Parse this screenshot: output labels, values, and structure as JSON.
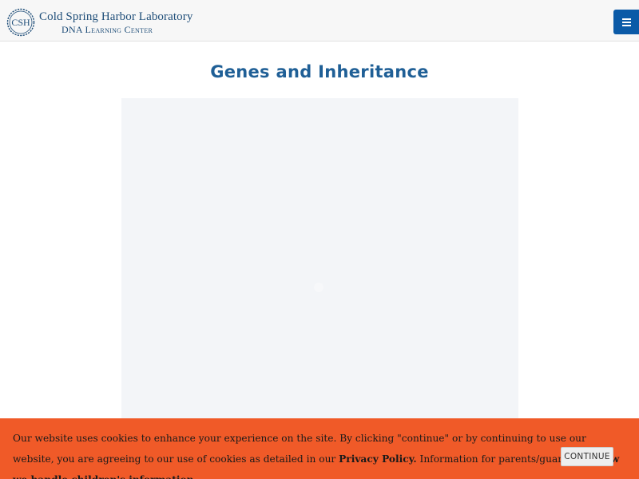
{
  "header": {
    "logo_mark_text": "CSH",
    "logo_line1": "Cold Spring Harbor Laboratory",
    "logo_line2": "DNA Learning Center",
    "menu_icon": "hamburger-menu-icon"
  },
  "main": {
    "title": "Genes and Inheritance"
  },
  "cookie_banner": {
    "text_part1": "Our website uses cookies to enhance your experience on the site. By clicking \"continue\" or by continuing to use our website, you are agreeing to our use of cookies as detailed in our ",
    "privacy_link": "Privacy Policy.",
    "text_part2": " Information for parents/guardians: ",
    "children_link": "How we handle children's information",
    "text_part3": ".",
    "continue_label": "CONTINUE"
  },
  "colors": {
    "header_bg": "#f7f7f7",
    "brand_blue": "#1f4e79",
    "title_blue": "#1f5f96",
    "menu_button": "#0b5aa7",
    "banner_orange": "#f05a28",
    "media_bg": "#f3f5f8"
  }
}
